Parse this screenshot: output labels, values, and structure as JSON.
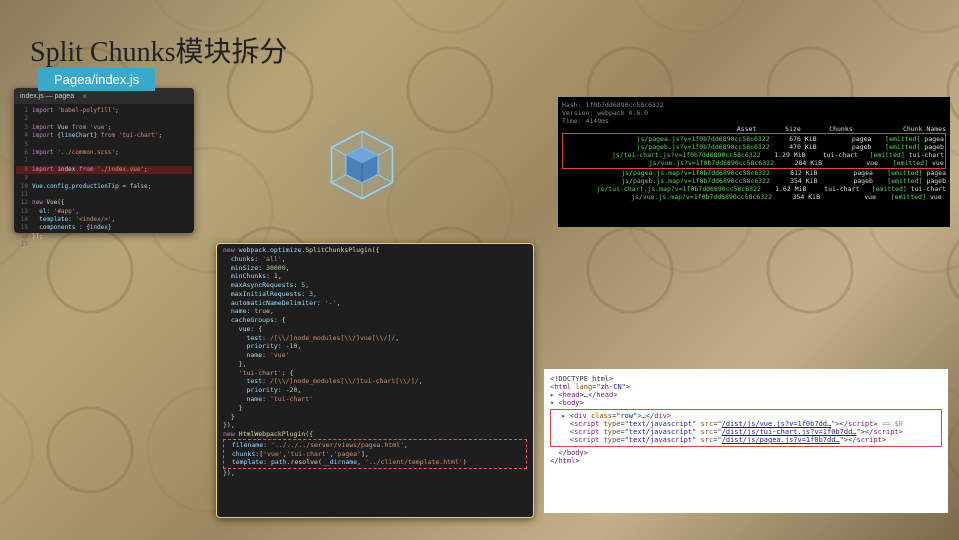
{
  "title": "Split Chunks模块拆分",
  "tab_label": "Pagea/index.js",
  "editor": {
    "tab": "index.js — pagea",
    "lines": [
      {
        "n": 1,
        "html": "<span class='kw'>import</span> <span class='str'>'babel-polyfill'</span>;"
      },
      {
        "n": 2,
        "html": ""
      },
      {
        "n": 3,
        "html": "<span class='kw'>import</span> <span class='var'>Vue</span> <span class='kw'>from</span> <span class='str'>'vue'</span>;"
      },
      {
        "n": 4,
        "html": "<span class='kw'>import</span> {<span class='var'>lineChart</span>} <span class='kw'>from</span> <span class='str'>'tui-chart'</span>;"
      },
      {
        "n": 5,
        "html": ""
      },
      {
        "n": 6,
        "html": "<span class='kw'>import</span> <span class='str'>'../common.scss'</span>;"
      },
      {
        "n": 7,
        "html": ""
      },
      {
        "n": 8,
        "html": "<span class='kw'>import</span> <span class='var'>index</span> <span class='kw'>from</span> <span class='str'>'./index.vue'</span>;",
        "hl": true
      },
      {
        "n": 9,
        "html": ""
      },
      {
        "n": 10,
        "html": "<span class='var'>Vue</span>.<span class='var'>config</span>.<span class='var'>productionTip</span> = <span class='num'>false</span>;"
      },
      {
        "n": 11,
        "html": ""
      },
      {
        "n": 12,
        "html": "<span class='kw'>new</span> <span class='fn'>Vue</span>({"
      },
      {
        "n": 13,
        "html": "&nbsp;&nbsp;<span class='var'>el</span>: <span class='str'>'#app'</span>,"
      },
      {
        "n": 14,
        "html": "&nbsp;&nbsp;<span class='var'>template</span>: <span class='str'>'&lt;index/&gt;'</span>,"
      },
      {
        "n": 15,
        "html": "&nbsp;&nbsp;<span class='var'>components</span> : {<span class='var'>index</span>}"
      },
      {
        "n": 16,
        "html": "});"
      },
      {
        "n": 17,
        "html": ""
      }
    ]
  },
  "config": {
    "lines": [
      "<span class='kw'>new</span> <span class='var'>webpack</span>.<span class='var'>optimize</span>.<span class='fn'>SplitChunksPlugin</span>({",
      "&nbsp;&nbsp;<span class='var'>chunks</span>: <span class='str'>'all'</span>,",
      "&nbsp;&nbsp;<span class='var'>minSize</span>: <span class='num'>30000</span>,",
      "&nbsp;&nbsp;<span class='var'>minChunks</span>: <span class='num'>1</span>,",
      "&nbsp;&nbsp;<span class='var'>maxAsyncRequests</span>: <span class='num'>5</span>,",
      "&nbsp;&nbsp;<span class='var'>maxInitialRequests</span>: <span class='num'>3</span>,",
      "&nbsp;&nbsp;<span class='var'>automaticNameDelimiter</span>: <span class='str'>'-'</span>,",
      "&nbsp;&nbsp;<span class='var'>name</span>: <span class='num'>true</span>,",
      "&nbsp;&nbsp;<span class='var'>cacheGroups</span>: {",
      "&nbsp;&nbsp;&nbsp;&nbsp;<span class='var'>vue</span>: {",
      "&nbsp;&nbsp;&nbsp;&nbsp;&nbsp;&nbsp;<span class='var'>test</span>: <span class='str'>/[\\\\/]node_modules[\\\\/]vue[\\\\/]/</span>,",
      "&nbsp;&nbsp;&nbsp;&nbsp;&nbsp;&nbsp;<span class='var'>priority</span>: <span class='num'>-10</span>,",
      "&nbsp;&nbsp;&nbsp;&nbsp;&nbsp;&nbsp;<span class='var'>name</span>: <span class='str'>'vue'</span>",
      "&nbsp;&nbsp;&nbsp;&nbsp;},",
      "&nbsp;&nbsp;&nbsp;&nbsp;<span class='str'>'tui-chart'</span>: {",
      "&nbsp;&nbsp;&nbsp;&nbsp;&nbsp;&nbsp;<span class='var'>test</span>: <span class='str'>/[\\\\/]node_modules[\\\\/]tui-chart[\\\\/]/</span>,",
      "&nbsp;&nbsp;&nbsp;&nbsp;&nbsp;&nbsp;<span class='var'>priority</span>: <span class='num'>-20</span>,",
      "&nbsp;&nbsp;&nbsp;&nbsp;&nbsp;&nbsp;<span class='var'>name</span>: <span class='str'>'tui-chart'</span>",
      "&nbsp;&nbsp;&nbsp;&nbsp;}",
      "&nbsp;&nbsp;}",
      "}),",
      "<span class='kw'>new</span> <span class='fn'>HtmlWebpackPlugin</span>({"
    ],
    "dashed": [
      "&nbsp;&nbsp;<span class='var'>filename</span>: <span class='str'>'../../../server/views/pagea.html'</span>,",
      "&nbsp;&nbsp;<span class='var'>chunks</span>:[<span class='str'>'vue'</span>,<span class='str'>'tui-chart'</span>,<span class='str'>'pagea'</span>],",
      "&nbsp;&nbsp;<span class='var'>template</span>: <span class='var'>path</span>.<span class='fn'>resolve</span>(<span class='var'>__dirname</span>, <span class='str'>'../client/template.html'</span>)"
    ],
    "after": "}),"
  },
  "terminal": {
    "hash": "Hash: 1f0b7dd6890cc58c6322",
    "version": "Version: webpack 4.6.0",
    "time": "Time: 4149ms",
    "headers": [
      "Asset",
      "Size",
      "Chunks",
      "",
      "Chunk Names"
    ],
    "boxed_rows": [
      {
        "asset": "js/pagea.js?v=1f0b7dd6890cc58c6322",
        "size": "676 KiB",
        "chunk": "pagea",
        "emit": "[emitted]",
        "name": "pagea"
      },
      {
        "asset": "js/pageb.js?v=1f0b7dd6890cc58c6322",
        "size": "470 KiB",
        "chunk": "pageb",
        "emit": "[emitted]",
        "name": "pageb"
      },
      {
        "asset": "js/tui-chart.js?v=1f0b7dd6890cc58c6322",
        "size": "1.29 MiB",
        "chunk": "tui-chart",
        "emit": "[emitted]",
        "name": "tui-chart"
      },
      {
        "asset": "js/vue.js?v=1f0b7dd6890cc58c6322",
        "size": "284 KiB",
        "chunk": "vue",
        "emit": "[emitted]",
        "name": "vue"
      }
    ],
    "rows": [
      {
        "asset": "js/pagea.js.map?v=1f0b7dd6890cc58c6322",
        "size": "612 KiB",
        "chunk": "pagea",
        "emit": "[emitted]",
        "name": "pagea"
      },
      {
        "asset": "js/pageb.js.map?v=1f0b7dd6890cc58c6322",
        "size": "354 KiB",
        "chunk": "pageb",
        "emit": "[emitted]",
        "name": "pageb"
      },
      {
        "asset": "js/tui-chart.js.map?v=1f0b7dd6890cc58c6322",
        "size": "1.62 MiB",
        "chunk": "tui-chart",
        "emit": "[emitted]",
        "name": "tui-chart"
      },
      {
        "asset": "js/vue.js.map?v=1f0b7dd6890cc58c6322",
        "size": "354 KiB",
        "chunk": "vue",
        "emit": "[emitted]",
        "name": "vue"
      }
    ]
  },
  "html_panel": {
    "lines_before": [
      "&lt;!DOCTYPE html&gt;",
      "&lt;<span class='html-tag'>html</span> <span class='html-attr'>lang</span>=<span class='html-str'>\"zh-CN\"</span>&gt;",
      "▸ &lt;<span class='html-tag'>head</span>&gt;…&lt;/<span class='html-tag'>head</span>&gt;",
      "▾ &lt;<span class='html-tag'>body</span>&gt;"
    ],
    "boxed": [
      "&nbsp;&nbsp;▸ &lt;<span class='html-tag'>div</span> <span class='html-attr'>class</span>=<span class='html-str'>\"row\"</span>&gt;…&lt;/<span class='html-tag'>div</span>&gt;",
      "&nbsp;&nbsp;&nbsp;&nbsp;&lt;<span class='html-tag'>script</span> <span class='html-attr'>type</span>=<span class='html-str'>\"text/javascript\"</span> <span class='html-attr'>src</span>=\"<span class='html-link'>/dist/js/vue.js?v=1f0b7dd…</span>\"&gt;&lt;/<span class='html-tag'>script</span>&gt; <span class='html-gray'>== $0</span>",
      "&nbsp;&nbsp;&nbsp;&nbsp;&lt;<span class='html-tag'>script</span> <span class='html-attr'>type</span>=<span class='html-str'>\"text/javascript\"</span> <span class='html-attr'>src</span>=\"<span class='html-link'>/dist/js/tui-chart.js?v=1f0b7dd…</span>\"&gt;&lt;/<span class='html-tag'>script</span>&gt;",
      "&nbsp;&nbsp;&nbsp;&nbsp;&lt;<span class='html-tag'>script</span> <span class='html-attr'>type</span>=<span class='html-str'>\"text/javascript\"</span> <span class='html-attr'>src</span>=\"<span class='html-link'>/dist/js/pagea.js?v=1f0b7dd…</span>\"&gt;&lt;/<span class='html-tag'>script</span>&gt;"
    ],
    "lines_after": [
      "&nbsp;&nbsp;&lt;/<span class='html-tag'>body</span>&gt;",
      "&lt;/<span class='html-tag'>html</span>&gt;"
    ]
  }
}
